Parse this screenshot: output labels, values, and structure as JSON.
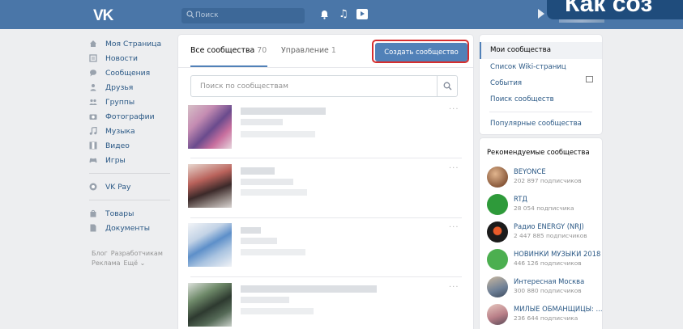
{
  "header": {
    "logo": "VK",
    "search_placeholder": "Поиск",
    "overlay_title": "Как соз"
  },
  "sidebar": {
    "items": [
      {
        "label": "Моя Страница",
        "icon": "home-icon"
      },
      {
        "label": "Новости",
        "icon": "news-icon"
      },
      {
        "label": "Сообщения",
        "icon": "messages-icon"
      },
      {
        "label": "Друзья",
        "icon": "friends-icon"
      },
      {
        "label": "Группы",
        "icon": "groups-icon"
      },
      {
        "label": "Фотографии",
        "icon": "camera-icon"
      },
      {
        "label": "Музыка",
        "icon": "music-icon"
      },
      {
        "label": "Видео",
        "icon": "video-icon"
      },
      {
        "label": "Игры",
        "icon": "gamepad-icon"
      }
    ],
    "vkpay": "VK Pay",
    "extra": [
      {
        "label": "Товары",
        "icon": "bag-icon"
      },
      {
        "label": "Документы",
        "icon": "document-icon"
      }
    ],
    "footer": {
      "blog": "Блог",
      "developers": "Разработчикам",
      "ads": "Реклама",
      "more": "Ещё ⌄"
    }
  },
  "main": {
    "tab_all_label": "Все сообщества",
    "tab_all_count": "70",
    "tab_manage_label": "Управление",
    "tab_manage_count": "1",
    "create_button": "Создать сообщество",
    "search_placeholder": "Поиск по сообществам",
    "more_glyph": "···"
  },
  "right_menu": {
    "items": [
      "Мои сообщества",
      "Список Wiki-страниц",
      "События",
      "Поиск сообществ",
      "Популярные сообщества"
    ]
  },
  "recommended": {
    "title": "Рекомендуемые сообщества",
    "items": [
      {
        "name": "BEYONCE",
        "subs": "202 897 подписчиков",
        "color": "#8a5a3c"
      },
      {
        "name": "RTД",
        "subs": "28 054 подписчика",
        "color": "#2e9a3a"
      },
      {
        "name": "Радио ENERGY (NRJ)",
        "subs": "2 447 885 подписчиков",
        "color": "#1b1b1b"
      },
      {
        "name": "НОВИНКИ МУЗЫКИ 2018",
        "subs": "446 126 подписчиков",
        "color": "#4caf50"
      },
      {
        "name": "Интересная Москва",
        "subs": "300 880 подписчиков",
        "color": "#6d7f96"
      },
      {
        "name": "МИЛЫЕ ОБМАНЩИЦЫ: ...",
        "subs": "236 644 подписчика",
        "color": "#b97f88"
      }
    ]
  },
  "colors": {
    "accent": "#5181b8",
    "header": "#4a76a8",
    "highlight": "#d62e2e"
  }
}
